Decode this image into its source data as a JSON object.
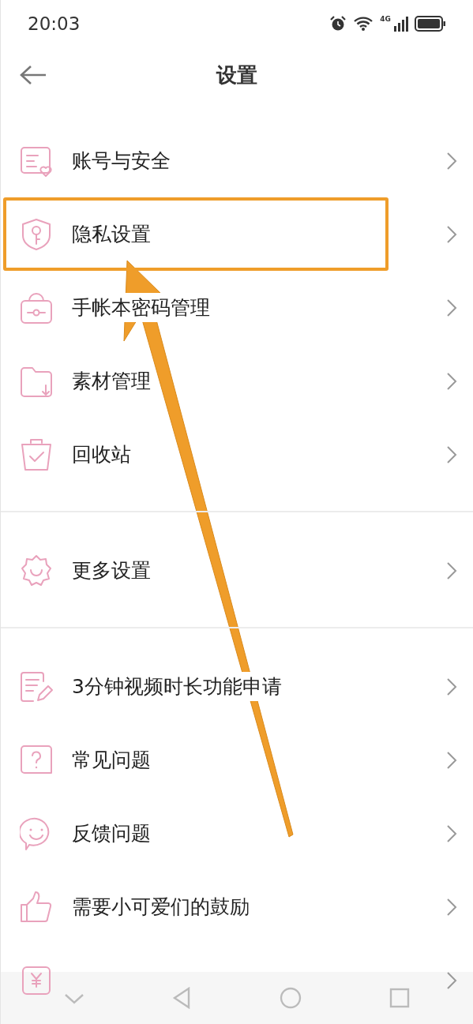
{
  "status_bar": {
    "time": "20:03",
    "network": "4G"
  },
  "header": {
    "title": "设置"
  },
  "groups": [
    {
      "items": [
        {
          "label": "账号与安全",
          "highlighted": false
        },
        {
          "label": "隐私设置",
          "highlighted": true
        },
        {
          "label": "手帐本密码管理",
          "highlighted": false
        },
        {
          "label": "素材管理",
          "highlighted": false
        },
        {
          "label": "回收站",
          "highlighted": false
        }
      ]
    },
    {
      "items": [
        {
          "label": "更多设置",
          "highlighted": false
        }
      ]
    },
    {
      "items": [
        {
          "label": "3分钟视频时长功能申请",
          "highlighted": false
        },
        {
          "label": "常见问题",
          "highlighted": false
        },
        {
          "label": "反馈问题",
          "highlighted": false
        },
        {
          "label": "需要小可爱们的鼓励",
          "highlighted": false
        },
        {
          "partial": true,
          "highlighted": false
        }
      ]
    }
  ]
}
